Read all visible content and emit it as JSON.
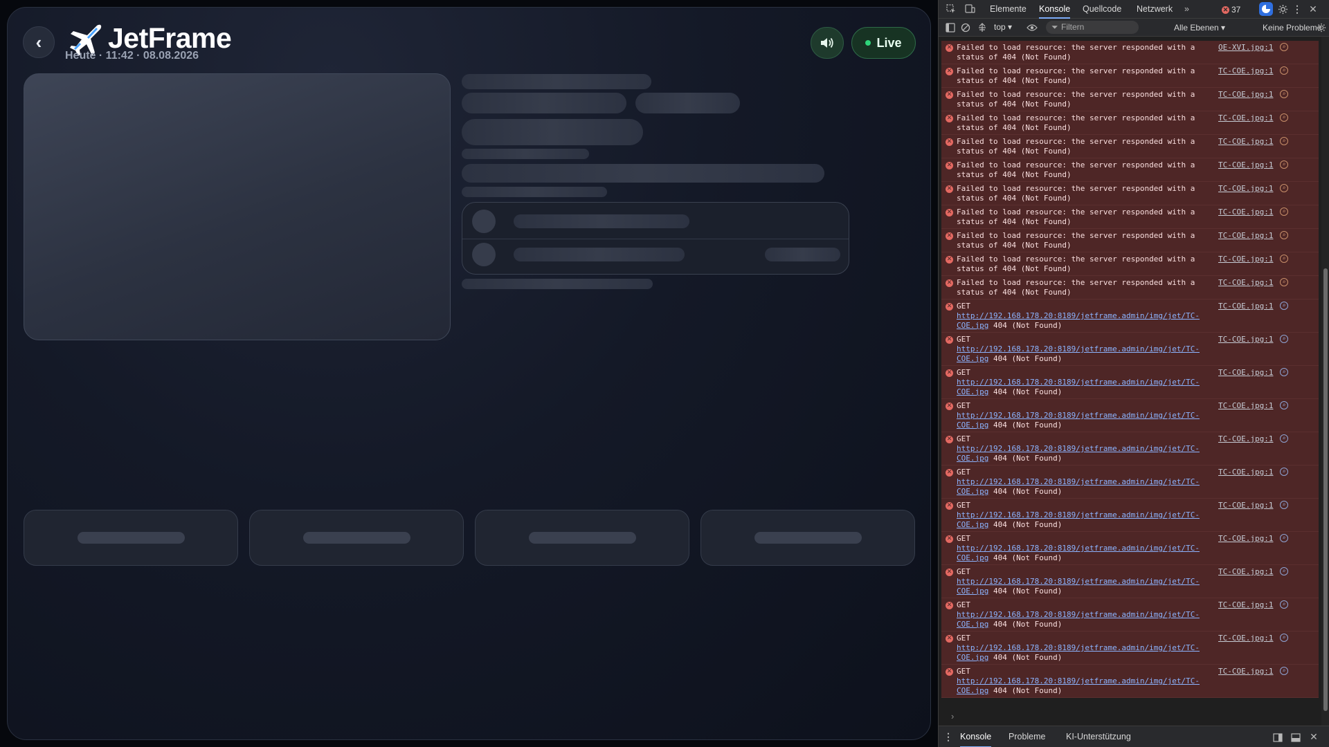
{
  "app": {
    "back_glyph": "‹",
    "brand": "JetFrame",
    "subtitle": "Heute · 11:42 · 08.08.2026",
    "live_label": "Live",
    "accent_live": "#2fd47a",
    "logo_icon": "airplane-icon",
    "sound_icon": "speaker-icon",
    "skeleton_tile_count": 4
  },
  "devtools": {
    "tabs": [
      "Elemente",
      "Konsole",
      "Quellcode",
      "Netzwerk"
    ],
    "active_tab": "Konsole",
    "more_tabs_glyph": "»",
    "error_count": "37",
    "context": "top ▾",
    "filter_placeholder": "Filtern",
    "levels": "Alle Ebenen ▾",
    "issues": "Keine Probleme",
    "error_color": "#e46962",
    "messages": [
      {
        "type": "fail",
        "text": "Failed to load resource: the server responded with a status of 404 (Not Found)",
        "source": "OE-XVI.jpg:1"
      },
      {
        "type": "fail",
        "text": "Failed to load resource: the server responded with a status of 404 (Not Found)",
        "source": "TC-COE.jpg:1"
      },
      {
        "type": "fail",
        "text": "Failed to load resource: the server responded with a status of 404 (Not Found)",
        "source": "TC-COE.jpg:1"
      },
      {
        "type": "fail",
        "text": "Failed to load resource: the server responded with a status of 404 (Not Found)",
        "source": "TC-COE.jpg:1"
      },
      {
        "type": "fail",
        "text": "Failed to load resource: the server responded with a status of 404 (Not Found)",
        "source": "TC-COE.jpg:1"
      },
      {
        "type": "fail",
        "text": "Failed to load resource: the server responded with a status of 404 (Not Found)",
        "source": "TC-COE.jpg:1"
      },
      {
        "type": "fail",
        "text": "Failed to load resource: the server responded with a status of 404 (Not Found)",
        "source": "TC-COE.jpg:1"
      },
      {
        "type": "fail",
        "text": "Failed to load resource: the server responded with a status of 404 (Not Found)",
        "source": "TC-COE.jpg:1"
      },
      {
        "type": "fail",
        "text": "Failed to load resource: the server responded with a status of 404 (Not Found)",
        "source": "TC-COE.jpg:1"
      },
      {
        "type": "fail",
        "text": "Failed to load resource: the server responded with a status of 404 (Not Found)",
        "source": "TC-COE.jpg:1"
      },
      {
        "type": "fail",
        "text": "Failed to load resource: the server responded with a status of 404 (Not Found)",
        "source": "TC-COE.jpg:1"
      },
      {
        "type": "get",
        "method": "GET",
        "url": "http://192.168.178.20:8189/jetframe.admin/img/jet/TC-COE.jpg",
        "status": "404 (Not Found)",
        "source": "TC-COE.jpg:1"
      },
      {
        "type": "get",
        "method": "GET",
        "url": "http://192.168.178.20:8189/jetframe.admin/img/jet/TC-COE.jpg",
        "status": "404 (Not Found)",
        "source": "TC-COE.jpg:1"
      },
      {
        "type": "get",
        "method": "GET",
        "url": "http://192.168.178.20:8189/jetframe.admin/img/jet/TC-COE.jpg",
        "status": "404 (Not Found)",
        "source": "TC-COE.jpg:1"
      },
      {
        "type": "get",
        "method": "GET",
        "url": "http://192.168.178.20:8189/jetframe.admin/img/jet/TC-COE.jpg",
        "status": "404 (Not Found)",
        "source": "TC-COE.jpg:1"
      },
      {
        "type": "get",
        "method": "GET",
        "url": "http://192.168.178.20:8189/jetframe.admin/img/jet/TC-COE.jpg",
        "status": "404 (Not Found)",
        "source": "TC-COE.jpg:1"
      },
      {
        "type": "get",
        "method": "GET",
        "url": "http://192.168.178.20:8189/jetframe.admin/img/jet/TC-COE.jpg",
        "status": "404 (Not Found)",
        "source": "TC-COE.jpg:1"
      },
      {
        "type": "get",
        "method": "GET",
        "url": "http://192.168.178.20:8189/jetframe.admin/img/jet/TC-COE.jpg",
        "status": "404 (Not Found)",
        "source": "TC-COE.jpg:1"
      },
      {
        "type": "get",
        "method": "GET",
        "url": "http://192.168.178.20:8189/jetframe.admin/img/jet/TC-COE.jpg",
        "status": "404 (Not Found)",
        "source": "TC-COE.jpg:1"
      },
      {
        "type": "get",
        "method": "GET",
        "url": "http://192.168.178.20:8189/jetframe.admin/img/jet/TC-COE.jpg",
        "status": "404 (Not Found)",
        "source": "TC-COE.jpg:1"
      },
      {
        "type": "get",
        "method": "GET",
        "url": "http://192.168.178.20:8189/jetframe.admin/img/jet/TC-COE.jpg",
        "status": "404 (Not Found)",
        "source": "TC-COE.jpg:1"
      },
      {
        "type": "get",
        "method": "GET",
        "url": "http://192.168.178.20:8189/jetframe.admin/img/jet/TC-COE.jpg",
        "status": "404 (Not Found)",
        "source": "TC-COE.jpg:1"
      },
      {
        "type": "get",
        "method": "GET",
        "url": "http://192.168.178.20:8189/jetframe.admin/img/jet/TC-COE.jpg",
        "status": "404 (Not Found)",
        "source": "TC-COE.jpg:1"
      }
    ],
    "prompt_glyph": "›",
    "drawer_tabs": [
      "Konsole",
      "Probleme",
      "KI-Unterstützung"
    ],
    "drawer_active": "Konsole"
  }
}
